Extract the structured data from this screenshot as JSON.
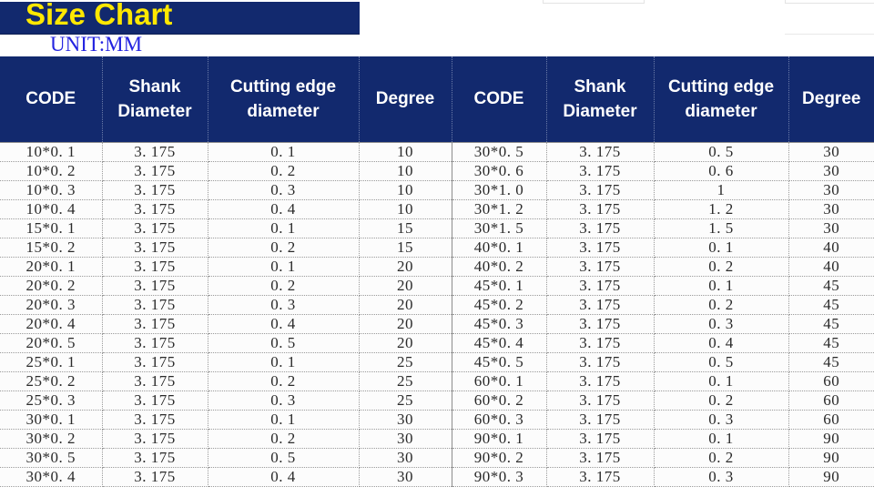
{
  "title": "Size Chart",
  "unit": "UNIT:MM",
  "colors": {
    "header_navy": "#12296e",
    "title_yellow": "#ffe800",
    "unit_blue": "#2424e0",
    "header_text": "#ffffff",
    "cell_text": "#2a2a2a"
  },
  "headers": {
    "code": "CODE",
    "shank_diameter": "Shank Diameter",
    "cutting_edge_diameter": "Cutting edge diameter",
    "degree": "Degree"
  },
  "header_row": [
    "CODE",
    "Shank Diameter",
    "Cutting edge diameter",
    "Degree",
    "CODE",
    "Shank Diameter",
    "Cutting edge diameter",
    "Degree"
  ],
  "rows": [
    [
      "10*0. 1",
      "3. 175",
      "0. 1",
      "10",
      "30*0. 5",
      "3. 175",
      "0. 5",
      "30"
    ],
    [
      "10*0. 2",
      "3. 175",
      "0. 2",
      "10",
      "30*0. 6",
      "3. 175",
      "0. 6",
      "30"
    ],
    [
      "10*0. 3",
      "3. 175",
      "0. 3",
      "10",
      "30*1. 0",
      "3. 175",
      "1",
      "30"
    ],
    [
      "10*0. 4",
      "3. 175",
      "0. 4",
      "10",
      "30*1. 2",
      "3. 175",
      "1. 2",
      "30"
    ],
    [
      "15*0. 1",
      "3. 175",
      "0. 1",
      "15",
      "30*1. 5",
      "3. 175",
      "1. 5",
      "30"
    ],
    [
      "15*0. 2",
      "3. 175",
      "0. 2",
      "15",
      "40*0. 1",
      "3. 175",
      "0. 1",
      "40"
    ],
    [
      "20*0. 1",
      "3. 175",
      "0. 1",
      "20",
      "40*0. 2",
      "3. 175",
      "0. 2",
      "40"
    ],
    [
      "20*0. 2",
      "3. 175",
      "0. 2",
      "20",
      "45*0. 1",
      "3. 175",
      "0. 1",
      "45"
    ],
    [
      "20*0. 3",
      "3. 175",
      "0. 3",
      "20",
      "45*0. 2",
      "3. 175",
      "0. 2",
      "45"
    ],
    [
      "20*0. 4",
      "3. 175",
      "0. 4",
      "20",
      "45*0. 3",
      "3. 175",
      "0. 3",
      "45"
    ],
    [
      "20*0. 5",
      "3. 175",
      "0. 5",
      "20",
      "45*0. 4",
      "3. 175",
      "0. 4",
      "45"
    ],
    [
      "25*0. 1",
      "3. 175",
      "0. 1",
      "25",
      "45*0. 5",
      "3. 175",
      "0. 5",
      "45"
    ],
    [
      "25*0. 2",
      "3. 175",
      "0. 2",
      "25",
      "60*0. 1",
      "3. 175",
      "0. 1",
      "60"
    ],
    [
      "25*0. 3",
      "3. 175",
      "0. 3",
      "25",
      "60*0. 2",
      "3. 175",
      "0. 2",
      "60"
    ],
    [
      "30*0. 1",
      "3. 175",
      "0. 1",
      "30",
      "60*0. 3",
      "3. 175",
      "0. 3",
      "60"
    ],
    [
      "30*0. 2",
      "3. 175",
      "0. 2",
      "30",
      "90*0. 1",
      "3. 175",
      "0. 1",
      "90"
    ],
    [
      "30*0. 5",
      "3. 175",
      "0. 5",
      "30",
      "90*0. 2",
      "3. 175",
      "0. 2",
      "90"
    ],
    [
      "30*0. 4",
      "3. 175",
      "0. 4",
      "30",
      "90*0. 3",
      "3. 175",
      "0. 3",
      "90"
    ]
  ]
}
